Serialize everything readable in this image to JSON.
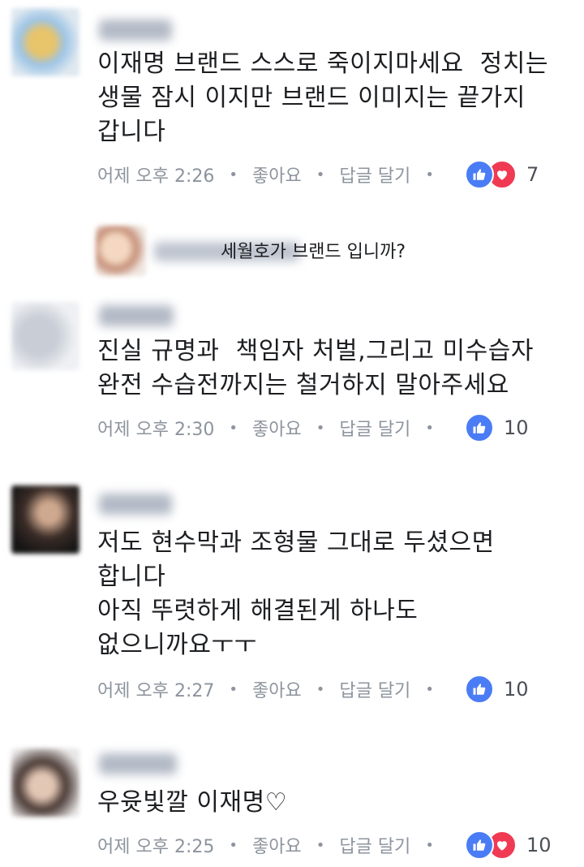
{
  "comments": [
    {
      "text": "이재명 브랜드 스스로 죽이지마세요  정치는\n생물 잠시 이지만 브랜드 이미지는 끝가지\n갑니다",
      "time": "어제 오후 2:26",
      "like": "좋아요",
      "reply": "답글 달기",
      "reactions": [
        "like-icon",
        "love-icon"
      ],
      "count": "7"
    },
    {
      "text": "진실 규명과  책임자 처벌,그리고 미수습자\n완전 수습전까지는 철거하지 말아주세요",
      "time": "어제 오후 2:30",
      "like": "좋아요",
      "reply": "답글 달기",
      "reactions": [
        "like-icon"
      ],
      "count": "10"
    },
    {
      "text": "저도 현수막과 조형물 그대로 두셨으면\n합니다\n아직 뚜렷하게 해결된게 하나도\n없으니까요ㅜㅜ",
      "time": "어제 오후 2:27",
      "like": "좋아요",
      "reply": "답글 달기",
      "reactions": [
        "like-icon"
      ],
      "count": "10"
    },
    {
      "text": "우윳빛깔 이재명♡",
      "time": "어제 오후 2:25",
      "like": "좋아요",
      "reply": "답글 달기",
      "reactions": [
        "like-icon",
        "love-icon"
      ],
      "count": "10"
    }
  ],
  "reply_preview": {
    "text": "세월호가 브랜드 입니까?"
  },
  "colors": {
    "like": "#4a7cf5",
    "love": "#f03a53",
    "meta": "#8d949e"
  }
}
